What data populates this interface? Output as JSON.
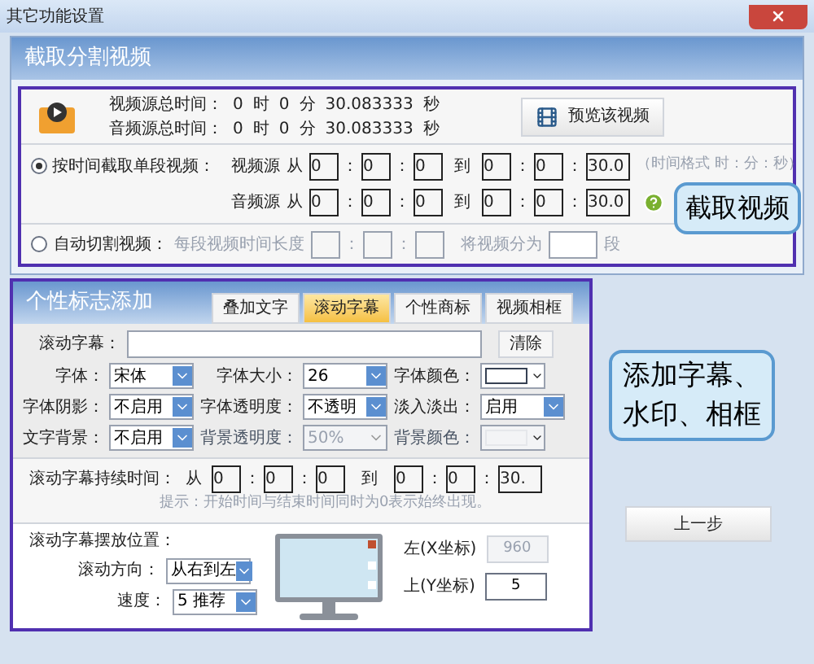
{
  "window": {
    "title": "其它功能设置"
  },
  "split": {
    "title": "截取分割视频",
    "totals": [
      {
        "label": "视频源总时间：",
        "parts": [
          "0",
          "时",
          "0",
          "分",
          "30.083333",
          "秒"
        ]
      },
      {
        "label": "音频源总时间：",
        "parts": [
          "0",
          "时",
          "0",
          "分",
          "30.083333",
          "秒"
        ]
      }
    ],
    "preview_button": "预览该视频",
    "modes": [
      {
        "kind": "range",
        "label": "按时间截取单段视频：",
        "selected": true,
        "format_hint": "（时间格式 时：分：秒）",
        "rows": [
          {
            "source": "视频源",
            "from_label": "从",
            "from": [
              "0",
              "：",
              "0",
              "：",
              "0"
            ],
            "to_label": "到",
            "to": [
              "0",
              "：",
              "0",
              "：",
              "30.0"
            ]
          },
          {
            "source": "音频源",
            "from_label": "从",
            "from": [
              "0",
              "：",
              "0",
              "：",
              "0"
            ],
            "to_label": "到",
            "to": [
              "0",
              "：",
              "0",
              "：",
              "30.0"
            ]
          }
        ]
      },
      {
        "kind": "auto",
        "label": "自动切割视频：",
        "selected": false,
        "length_label": "每段视频时间长度",
        "separators": [
          "：",
          "："
        ],
        "split_label": "将视频分为",
        "split_unit": "段"
      }
    ]
  },
  "logo": {
    "title": "个性标志添加",
    "tabs": [
      {
        "label": "叠加文字",
        "selected": false
      },
      {
        "label": "滚动字幕",
        "selected": true
      },
      {
        "label": "个性商标",
        "selected": false
      },
      {
        "label": "视频相框",
        "selected": false
      }
    ],
    "caption": {
      "label": "滚动字幕：",
      "clear_button": "清除"
    },
    "style_rows": [
      [
        {
          "kind": "select",
          "label": "字体：",
          "value": "宋体",
          "disabled": false
        },
        {
          "kind": "select",
          "label": "字体大小：",
          "value": "26",
          "disabled": false
        },
        {
          "kind": "color",
          "label": "字体颜色：",
          "disabled": false
        }
      ],
      [
        {
          "kind": "select",
          "label": "字体阴影：",
          "value": "不启用",
          "disabled": false
        },
        {
          "kind": "select",
          "label": "字体透明度：",
          "value": "不透明",
          "disabled": false
        },
        {
          "kind": "select",
          "label": "淡入淡出：",
          "value": "启用",
          "disabled": false
        }
      ],
      [
        {
          "kind": "select",
          "label": "文字背景：",
          "value": "不启用",
          "disabled": false
        },
        {
          "kind": "select",
          "label": "背景透明度：",
          "value": "50%",
          "disabled": true
        },
        {
          "kind": "color",
          "label": "背景颜色：",
          "disabled": true
        }
      ]
    ],
    "duration": {
      "label": "滚动字幕持续时间：",
      "from_label": "从",
      "from": [
        "0",
        "：",
        "0",
        "：",
        "0"
      ],
      "to_label": "到",
      "to": [
        "0",
        "：",
        "0",
        "：",
        "30."
      ],
      "hint": "提示：开始时间与结束时间同时为0表示始终出现。"
    },
    "position": {
      "title": "滚动字幕摆放位置：",
      "direction_label": "滚动方向：",
      "direction": "从右到左",
      "speed_label": "速度：",
      "speed": "5 推荐",
      "coords": [
        {
          "label": "左(X坐标)",
          "value": "960",
          "disabled": true
        },
        {
          "label": "上(Y坐标)",
          "value": "5",
          "disabled": false
        }
      ]
    }
  },
  "back_button": "上一步",
  "callouts": [
    {
      "text": "截取视频"
    },
    {
      "text": "添加字幕、水印、相框"
    }
  ]
}
